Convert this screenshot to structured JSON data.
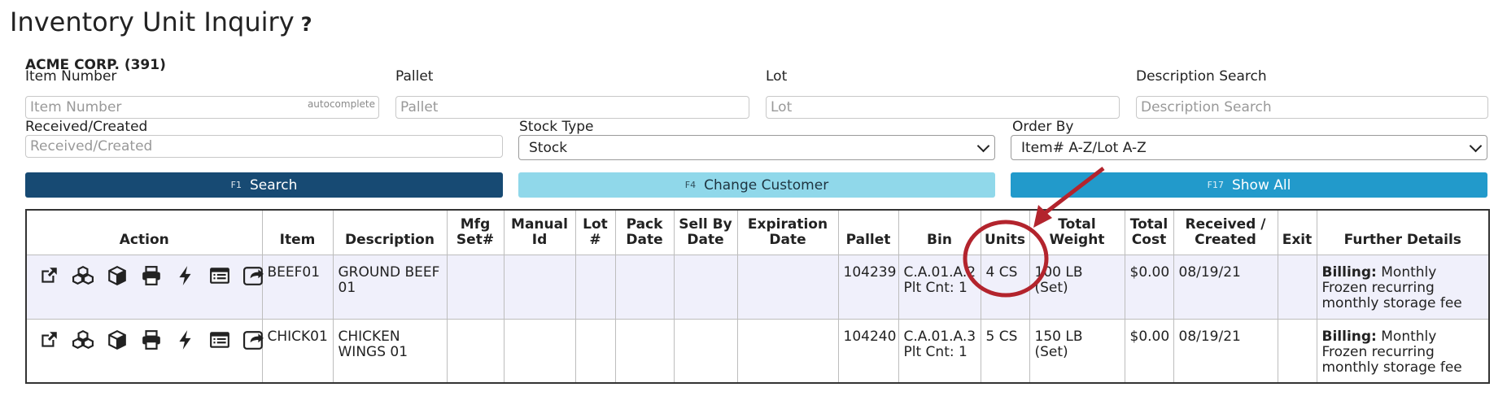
{
  "header": {
    "title": "Inventory Unit Inquiry",
    "help_icon": "?"
  },
  "company": "ACME CORP. (391)",
  "filters": {
    "item_number": {
      "label": "Item Number",
      "placeholder": "Item Number",
      "hint": "autocomplete"
    },
    "pallet": {
      "label": "Pallet",
      "placeholder": "Pallet"
    },
    "lot": {
      "label": "Lot",
      "placeholder": "Lot"
    },
    "description_search": {
      "label": "Description Search",
      "placeholder": "Description Search"
    },
    "received_created": {
      "label": "Received/Created",
      "placeholder": "Received/Created"
    },
    "stock_type": {
      "label": "Stock Type",
      "value": "Stock"
    },
    "order_by": {
      "label": "Order By",
      "value": "Item# A-Z/Lot A-Z"
    }
  },
  "buttons": {
    "search": {
      "key": "F1",
      "label": "Search"
    },
    "change_customer": {
      "key": "F4",
      "label": "Change Customer"
    },
    "show_all": {
      "key": "F17",
      "label": "Show All"
    }
  },
  "table": {
    "headers": {
      "action": "Action",
      "item": "Item",
      "description": "Description",
      "mfg_set_1": "Mfg",
      "mfg_set_2": "Set#",
      "manual_id_1": "Manual",
      "manual_id_2": "Id",
      "lot_1": "Lot",
      "lot_2": "#",
      "pack_date_1": "Pack",
      "pack_date_2": "Date",
      "sell_by_1": "Sell By",
      "sell_by_2": "Date",
      "expiration_1": "Expiration",
      "expiration_2": "Date",
      "pallet": "Pallet",
      "bin": "Bin",
      "units": "Units",
      "total_weight_1": "Total",
      "total_weight_2": "Weight",
      "total_cost_1": "Total",
      "total_cost_2": "Cost",
      "received_1": "Received /",
      "received_2": "Created",
      "exit": "Exit",
      "further_details": "Further Details"
    },
    "action_icons": [
      "external-link-icon",
      "boxes-icon",
      "box-icon",
      "print-icon",
      "bolt-icon",
      "list-icon",
      "share-icon"
    ],
    "rows": [
      {
        "item": "BEEF01",
        "description": "GROUND BEEF 01",
        "mfg_set": "",
        "manual_id": "",
        "lot": "",
        "pack_date": "",
        "sell_by": "",
        "expiration": "",
        "pallet": "104239",
        "bin": "C.A.01.A.2",
        "plt_cnt": "Plt Cnt: 1",
        "units": "4 CS",
        "total_weight": "100 LB (Set)",
        "total_cost": "$0.00",
        "received": "08/19/21",
        "exit": "",
        "details_label": "Billing:",
        "details_text": "Monthly Frozen recurring monthly storage fee"
      },
      {
        "item": "CHICK01",
        "description": "CHICKEN WINGS 01",
        "mfg_set": "",
        "manual_id": "",
        "lot": "",
        "pack_date": "",
        "sell_by": "",
        "expiration": "",
        "pallet": "104240",
        "bin": "C.A.01.A.3",
        "plt_cnt": "Plt Cnt: 1",
        "units": "5 CS",
        "total_weight": "150 LB (Set)",
        "total_cost": "$0.00",
        "received": "08/19/21",
        "exit": "",
        "details_label": "Billing:",
        "details_text": "Monthly Frozen recurring monthly storage fee"
      }
    ]
  },
  "annotation": {
    "color": "#b3242d",
    "shape": "circle-with-arrow",
    "target": "units-column"
  }
}
